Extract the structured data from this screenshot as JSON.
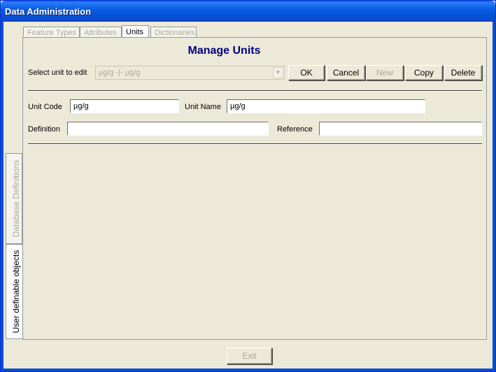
{
  "window": {
    "title": "Data Administration"
  },
  "side_tabs": [
    {
      "label": "Database Definitions",
      "active": false
    },
    {
      "label": "User definable objects",
      "active": true
    }
  ],
  "tabs": [
    {
      "label": "Feature Types",
      "active": false
    },
    {
      "label": "Attributes",
      "active": false
    },
    {
      "label": "Units",
      "active": true
    },
    {
      "label": "Dictionaries",
      "active": false
    }
  ],
  "units": {
    "heading": "Manage Units",
    "select_label": "Select unit to edit",
    "selected_unit": "µg/g -|- µg/g",
    "buttons": {
      "ok": "OK",
      "cancel": "Cancel",
      "new": "New",
      "copy": "Copy",
      "delete": "Delete"
    },
    "unit_code_label": "Unit Code",
    "unit_code_value": "µg/g",
    "unit_name_label": "Unit Name",
    "unit_name_value": "µg/g",
    "definition_label": "Definition",
    "definition_value": "",
    "reference_label": "Reference",
    "reference_value": ""
  },
  "footer": {
    "exit_label": "Exit"
  }
}
